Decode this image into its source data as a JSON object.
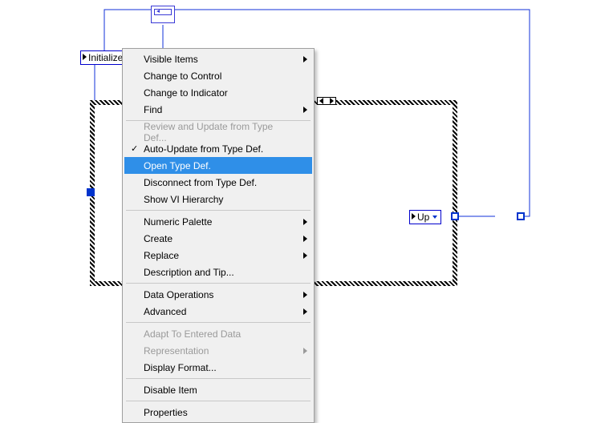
{
  "diagram": {
    "initialize_label": "Initialize",
    "up_label": "Up",
    "case_selector": ""
  },
  "menu": {
    "items": [
      {
        "label": "Visible Items",
        "submenu": true
      },
      {
        "label": "Change to Control"
      },
      {
        "label": "Change to Indicator"
      },
      {
        "label": "Find",
        "submenu": true
      },
      {
        "sep": true
      },
      {
        "label": "Review and Update from Type Def...",
        "disabled": true
      },
      {
        "label": "Auto-Update from Type Def.",
        "checked": true
      },
      {
        "label": "Open Type Def.",
        "highlight": true
      },
      {
        "label": "Disconnect from Type Def."
      },
      {
        "label": "Show VI Hierarchy"
      },
      {
        "sep": true
      },
      {
        "label": "Numeric Palette",
        "submenu": true
      },
      {
        "label": "Create",
        "submenu": true
      },
      {
        "label": "Replace",
        "submenu": true
      },
      {
        "label": "Description and Tip..."
      },
      {
        "sep": true
      },
      {
        "label": "Data Operations",
        "submenu": true
      },
      {
        "label": "Advanced",
        "submenu": true
      },
      {
        "sep": true
      },
      {
        "label": "Adapt To Entered Data",
        "disabled": true
      },
      {
        "label": "Representation",
        "disabled": true,
        "submenu": true
      },
      {
        "label": "Display Format..."
      },
      {
        "sep": true
      },
      {
        "label": "Disable Item"
      },
      {
        "sep": true
      },
      {
        "label": "Properties"
      }
    ]
  }
}
